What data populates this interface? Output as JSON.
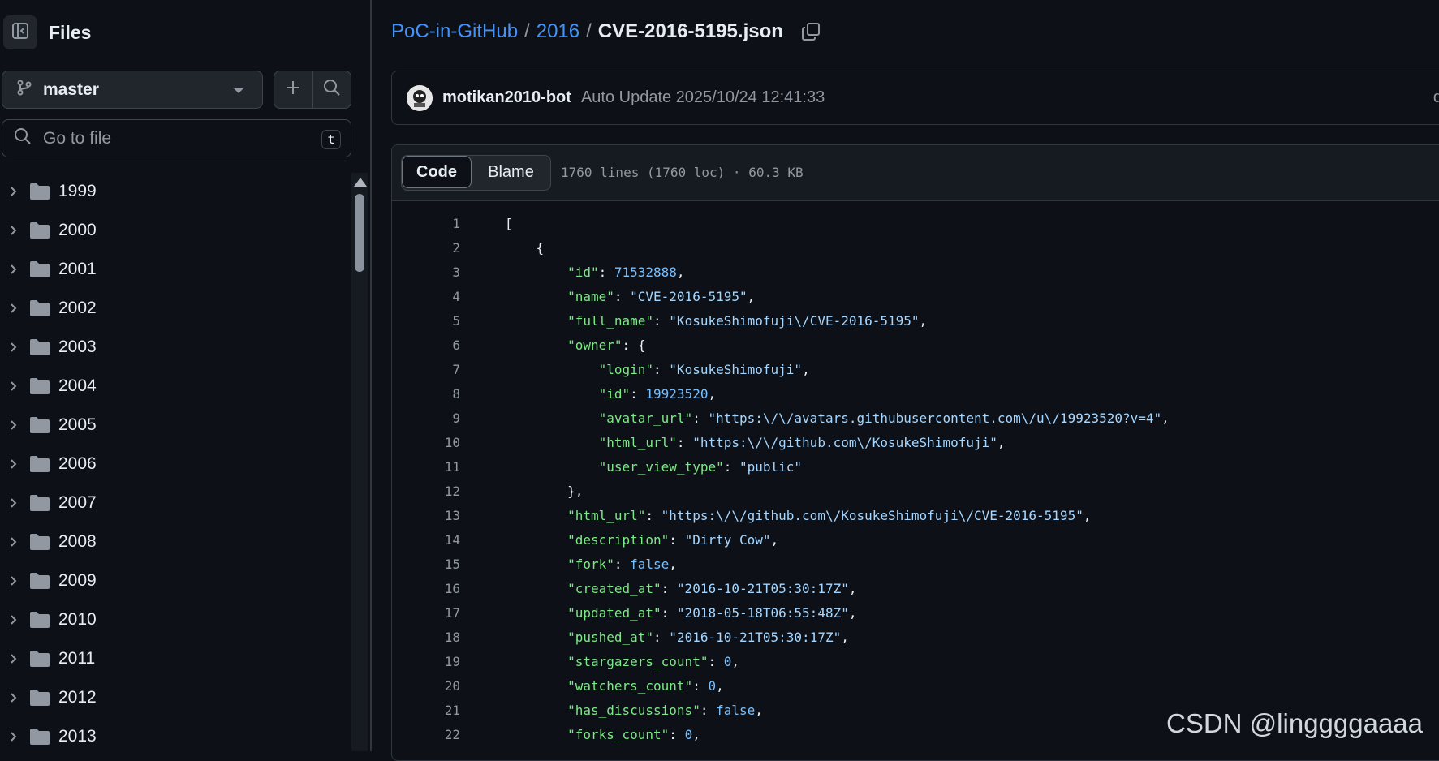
{
  "sidebar": {
    "title": "Files",
    "branch": "master",
    "search_placeholder": "Go to file",
    "search_shortcut": "t",
    "folders": [
      "1999",
      "2000",
      "2001",
      "2002",
      "2003",
      "2004",
      "2005",
      "2006",
      "2007",
      "2008",
      "2009",
      "2010",
      "2011",
      "2012",
      "2013"
    ]
  },
  "breadcrumb": {
    "repo": "PoC-in-GitHub",
    "folder": "2016",
    "file": "CVE-2016-5195.json",
    "separator": "/"
  },
  "commit": {
    "author": "motikan2010-bot",
    "message": "Auto Update 2025/10/24 12:41:33",
    "trailing_text": "d"
  },
  "file_view": {
    "tabs": [
      "Code",
      "Blame"
    ],
    "active_tab": "Code",
    "meta": "1760 lines (1760 loc) · 60.3 KB"
  },
  "code_lines": [
    {
      "n": "1",
      "indent": "",
      "key": "",
      "val": "",
      "type": "punct",
      "text": "["
    },
    {
      "n": "2",
      "indent": "    ",
      "key": "",
      "val": "",
      "type": "punct",
      "text": "{"
    },
    {
      "n": "3",
      "indent": "        ",
      "key": "\"id\"",
      "val": "71532888",
      "type": "num",
      "end": ","
    },
    {
      "n": "4",
      "indent": "        ",
      "key": "\"name\"",
      "val": "\"CVE-2016-5195\"",
      "type": "str",
      "end": ","
    },
    {
      "n": "5",
      "indent": "        ",
      "key": "\"full_name\"",
      "val": "\"KosukeShimofuji\\/CVE-2016-5195\"",
      "type": "str",
      "end": ","
    },
    {
      "n": "6",
      "indent": "        ",
      "key": "\"owner\"",
      "val": "{",
      "type": "punct",
      "end": ""
    },
    {
      "n": "7",
      "indent": "            ",
      "key": "\"login\"",
      "val": "\"KosukeShimofuji\"",
      "type": "str",
      "end": ","
    },
    {
      "n": "8",
      "indent": "            ",
      "key": "\"id\"",
      "val": "19923520",
      "type": "num",
      "end": ","
    },
    {
      "n": "9",
      "indent": "            ",
      "key": "\"avatar_url\"",
      "val": "\"https:\\/\\/avatars.githubusercontent.com\\/u\\/19923520?v=4\"",
      "type": "str",
      "end": ","
    },
    {
      "n": "10",
      "indent": "            ",
      "key": "\"html_url\"",
      "val": "\"https:\\/\\/github.com\\/KosukeShimofuji\"",
      "type": "str",
      "end": ","
    },
    {
      "n": "11",
      "indent": "            ",
      "key": "\"user_view_type\"",
      "val": "\"public\"",
      "type": "str",
      "end": ""
    },
    {
      "n": "12",
      "indent": "        ",
      "key": "",
      "val": "",
      "type": "punct",
      "text": "},"
    },
    {
      "n": "13",
      "indent": "        ",
      "key": "\"html_url\"",
      "val": "\"https:\\/\\/github.com\\/KosukeShimofuji\\/CVE-2016-5195\"",
      "type": "str",
      "end": ","
    },
    {
      "n": "14",
      "indent": "        ",
      "key": "\"description\"",
      "val": "\"Dirty Cow\"",
      "type": "str",
      "end": ","
    },
    {
      "n": "15",
      "indent": "        ",
      "key": "\"fork\"",
      "val": "false",
      "type": "num",
      "end": ","
    },
    {
      "n": "16",
      "indent": "        ",
      "key": "\"created_at\"",
      "val": "\"2016-10-21T05:30:17Z\"",
      "type": "str",
      "end": ","
    },
    {
      "n": "17",
      "indent": "        ",
      "key": "\"updated_at\"",
      "val": "\"2018-05-18T06:55:48Z\"",
      "type": "str",
      "end": ","
    },
    {
      "n": "18",
      "indent": "        ",
      "key": "\"pushed_at\"",
      "val": "\"2016-10-21T05:30:17Z\"",
      "type": "str",
      "end": ","
    },
    {
      "n": "19",
      "indent": "        ",
      "key": "\"stargazers_count\"",
      "val": "0",
      "type": "num",
      "end": ","
    },
    {
      "n": "20",
      "indent": "        ",
      "key": "\"watchers_count\"",
      "val": "0",
      "type": "num",
      "end": ","
    },
    {
      "n": "21",
      "indent": "        ",
      "key": "\"has_discussions\"",
      "val": "false",
      "type": "num",
      "end": ","
    },
    {
      "n": "22",
      "indent": "        ",
      "key": "\"forks_count\"",
      "val": "0",
      "type": "num",
      "end": ","
    }
  ],
  "watermark": "CSDN @linggggaaaa",
  "colors": {
    "background": "#0d1117",
    "link": "#4493f8",
    "json_key": "#7ee787",
    "json_string": "#a5d6ff",
    "json_number": "#79c0ff",
    "muted": "#9198a1"
  }
}
